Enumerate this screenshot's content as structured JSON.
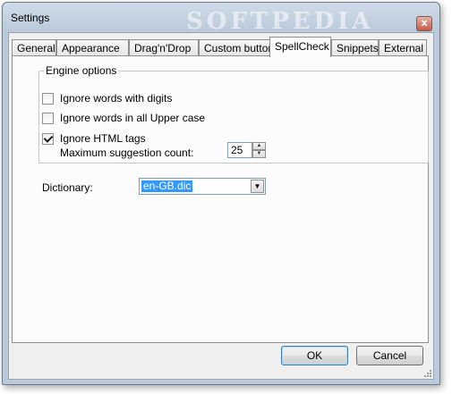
{
  "window": {
    "title": "Settings",
    "watermark": "SOFTPEDIA",
    "close_glyph": "x"
  },
  "tabs": [
    {
      "label": "General",
      "active": false
    },
    {
      "label": "Appearance",
      "active": false
    },
    {
      "label": "Drag'n'Drop",
      "active": false
    },
    {
      "label": "Custom buttons",
      "active": false
    },
    {
      "label": "SpellCheck",
      "active": true
    },
    {
      "label": "Snippets",
      "active": false
    },
    {
      "label": "External",
      "active": false
    }
  ],
  "engine_options": {
    "group_label": "Engine options",
    "options": [
      {
        "label": "Ignore words with digits",
        "checked": false
      },
      {
        "label": "Ignore words in all Upper case",
        "checked": false
      },
      {
        "label": "Ignore HTML tags",
        "checked": true
      }
    ],
    "max_suggestion_label": "Maximum suggestion count:",
    "max_suggestion_value": "25"
  },
  "dictionary": {
    "label": "Dictionary:",
    "selected": "en-GB.dic"
  },
  "buttons": {
    "ok": "OK",
    "cancel": "Cancel"
  },
  "icons": {
    "spin_up": "▲",
    "spin_down": "▼",
    "dropdown": "▼"
  }
}
